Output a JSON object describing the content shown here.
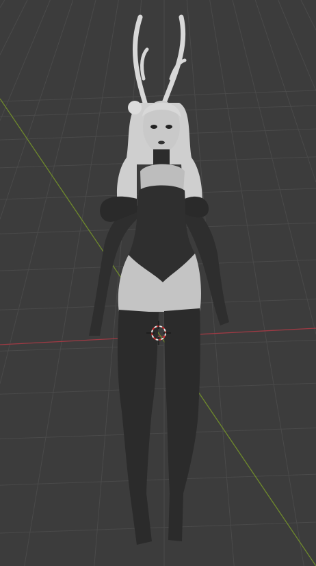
{
  "viewport": {
    "background_color": "#3c3c3c",
    "grid_color": "#4a4a4a",
    "x_axis_color": "#a03a44",
    "y_axis_color": "#6f8a2c",
    "cursor_icon": "3d-cursor-icon"
  },
  "model": {
    "skin_color": "#c8c8c8",
    "clothing_color": "#2c2c2c",
    "hair_color": "#d6d6d6"
  }
}
